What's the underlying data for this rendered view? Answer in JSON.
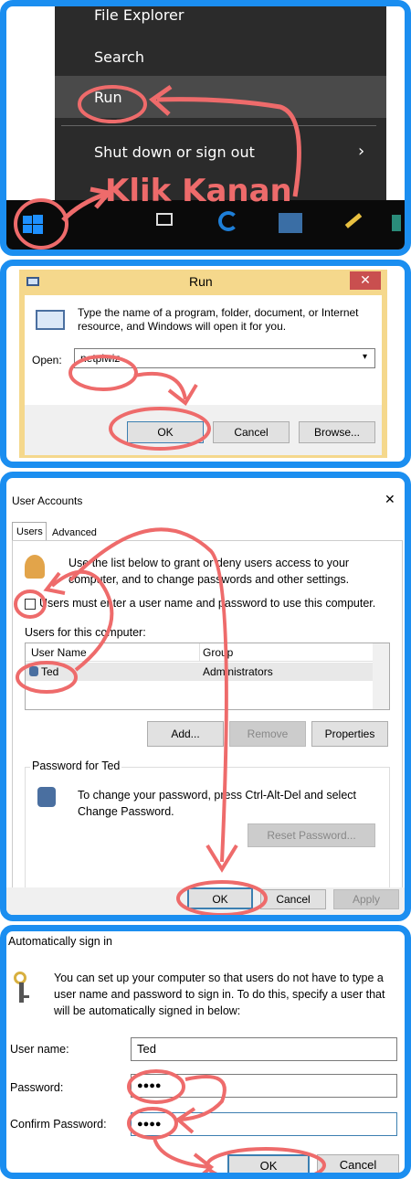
{
  "start_menu": {
    "items": [
      "File Explorer",
      "Search",
      "Run"
    ],
    "shutdown_label": "Shut down or sign out",
    "annotation": "Klik Kanan"
  },
  "run_dialog": {
    "title": "Run",
    "description": "Type the name of a program, folder, document, or Internet resource, and Windows will open it for you.",
    "open_label": "Open:",
    "open_value": "netplwiz",
    "ok_label": "OK",
    "cancel_label": "Cancel",
    "browse_label": "Browse..."
  },
  "user_accounts": {
    "title": "User Accounts",
    "tabs": [
      "Users",
      "Advanced"
    ],
    "intro": "Use the list below to grant or deny users access to your computer, and to change passwords and other settings.",
    "checkbox_label": "Users must enter a user name and password to use this computer.",
    "users_heading": "Users for this computer:",
    "columns": [
      "User Name",
      "Group"
    ],
    "rows": [
      {
        "name": "Ted",
        "group": "Administrators"
      }
    ],
    "add_label": "Add...",
    "remove_label": "Remove",
    "properties_label": "Properties",
    "password_heading": "Password for Ted",
    "password_text": "To change your password, press Ctrl-Alt-Del and select Change Password.",
    "reset_label": "Reset Password...",
    "ok_label": "OK",
    "cancel_label": "Cancel",
    "apply_label": "Apply"
  },
  "auto_signin": {
    "title": "Automatically sign in",
    "intro": "You can set up your computer so that users do not have to type a user name and password to sign in. To do this, specify a user that will be automatically signed in below:",
    "username_label": "User name:",
    "username_value": "Ted",
    "password_label": "Password:",
    "password_value": "●●●●",
    "confirm_label": "Confirm Password:",
    "confirm_value": "●●●●",
    "ok_label": "OK",
    "cancel_label": "Cancel"
  },
  "colors": {
    "frame": "#1b8ef0",
    "annotation": "#ee6b6b",
    "menu": "#2b2b2b",
    "run_frame": "#f5d88c"
  }
}
